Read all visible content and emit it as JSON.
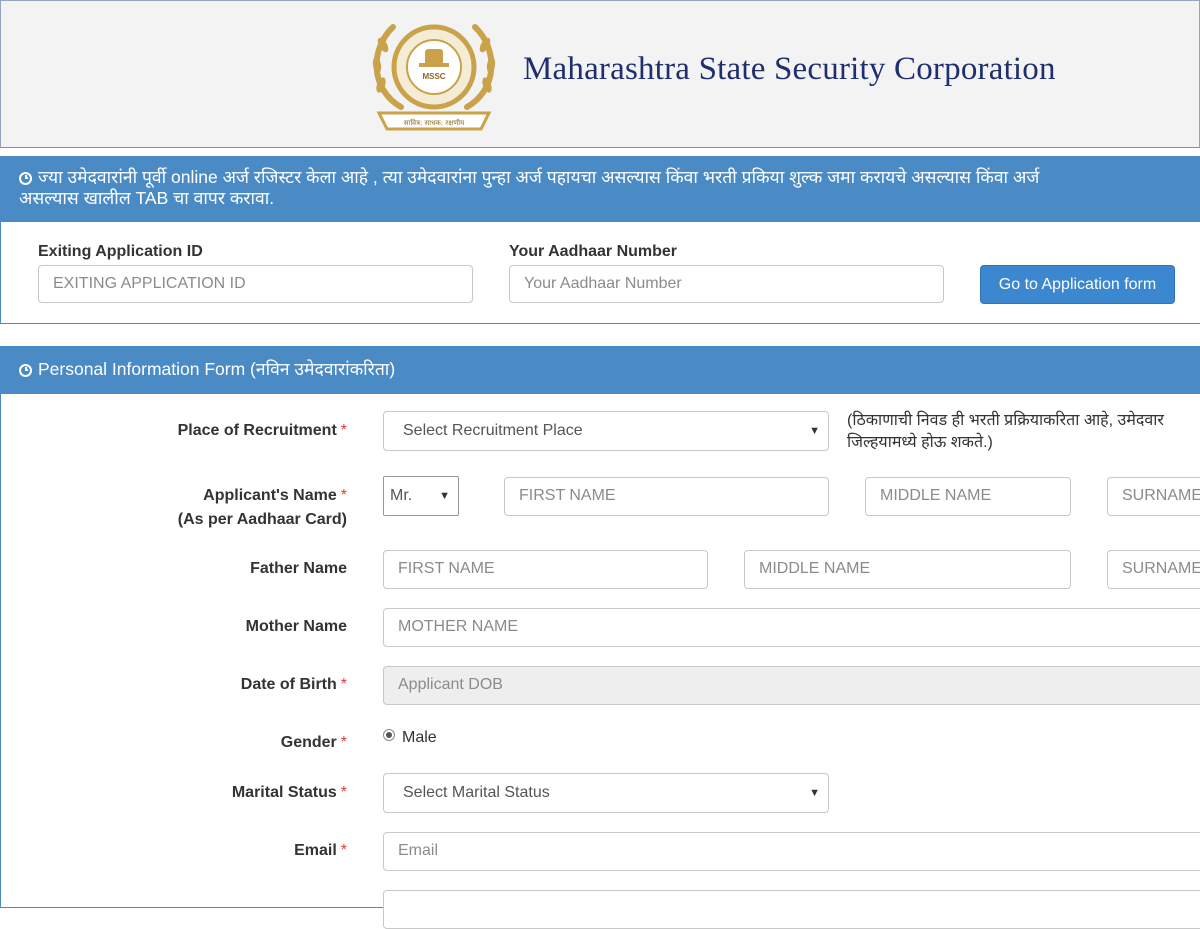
{
  "header": {
    "logo": {
      "ring_text": "Maharashtra State Security Corporation",
      "abbr": "MSSC",
      "ribbon_text": "सावित्र: साधक: रक्षणीय"
    },
    "title": "Maharashtra State Security Corporation"
  },
  "existing_panel": {
    "heading_line1": "ज्या उमेदवारांनी पूर्वी online अर्ज रजिस्टर केला आहे , त्या उमेदवारांना पुन्हा अर्ज पहायचा असल्यास किंवा भरती प्रकिया शुल्क जमा करायचे असल्यास किंवा अर्ज",
    "heading_line2": "असल्यास खालील TAB चा वापर करावा.",
    "app_id_label": "Exiting Application ID",
    "app_id_placeholder": "EXITING APPLICATION ID",
    "aadhaar_label": "Your Aadhaar Number",
    "aadhaar_placeholder": "Your Aadhaar Number",
    "go_button": "Go to Application form"
  },
  "personal_form": {
    "heading": "Personal Information Form (नविन उमेदवारांकरिता)",
    "recruitment_place": {
      "label": "Place of Recruitment",
      "required": "*",
      "selected": "Select Recruitment Place",
      "note_line1": "(ठिकाणाची निवड ही भरती प्रक्रियाकरिता आहे, उमेदवार",
      "note_line2": "जिल्हयामध्ये होऊ शकते.)"
    },
    "applicant_name": {
      "label": "Applicant's Name",
      "sub_label": "(As per Aadhaar Card)",
      "required": "*",
      "title_selected": "Mr.",
      "first": "FIRST NAME",
      "middle": "MIDDLE NAME",
      "surname": "SURNAME"
    },
    "father_name": {
      "label": "Father Name",
      "first": "FIRST NAME",
      "middle": "MIDDLE NAME",
      "surname": "SURNAME"
    },
    "mother_name": {
      "label": "Mother Name",
      "placeholder": "MOTHER NAME"
    },
    "dob": {
      "label": "Date of Birth",
      "required": "*",
      "placeholder": "Applicant DOB"
    },
    "gender": {
      "label": "Gender",
      "required": "*",
      "option": "Male"
    },
    "marital_status": {
      "label": "Marital Status",
      "required": "*",
      "selected": "Select Marital Status"
    },
    "email": {
      "label": "Email",
      "required": "*",
      "placeholder": "Email"
    }
  },
  "colors": {
    "panel_header": "#4a8bc6",
    "button": "#3b87d0",
    "title_text": "#1f2f6e",
    "required": "#e03b3b",
    "logo_gold": "#c9a24a"
  },
  "icons": {
    "heading_icon": "clock-icon",
    "select_arrow": "caret-down-icon"
  }
}
